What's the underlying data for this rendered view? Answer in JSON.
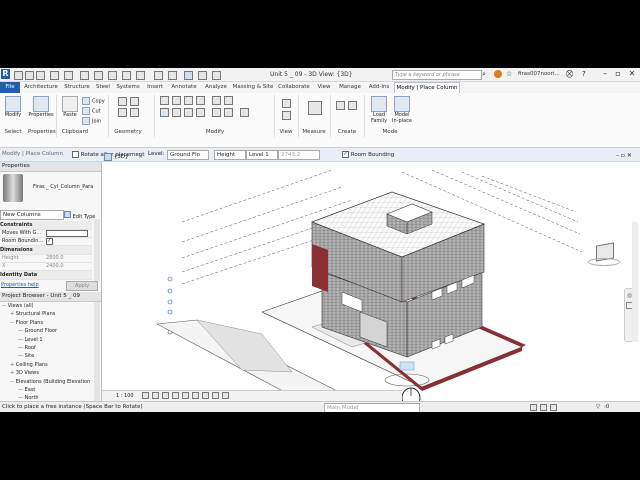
{
  "titlebar": {
    "logo": "R",
    "window_title": "Unit 5 _ 09 - 3D View: {3D}",
    "search_placeholder": "Type a keyword or phrase",
    "user": "firas007noori...",
    "help": "?"
  },
  "tabs": [
    "File",
    "Architecture",
    "Structure",
    "Steel",
    "Systems",
    "Insert",
    "Annotate",
    "Analyze",
    "Massing & Site",
    "Collaborate",
    "View",
    "Manage",
    "Add-Ins",
    "Modify | Place Column"
  ],
  "ribbon": {
    "modify_label": "Modify",
    "properties_label": "Properties",
    "paste_label": "Paste",
    "copy": "Copy",
    "cut": "Cut",
    "join": "Join",
    "load_family": "Load Family",
    "model_inplace": "Model In-place",
    "panels": {
      "select": "Select",
      "properties": "Properties",
      "clipboard": "Clipboard",
      "geometry": "Geometry",
      "modify": "Modify",
      "view": "View",
      "measure": "Measure",
      "create": "Create",
      "mode": "Mode"
    }
  },
  "options_bar": {
    "context": "Modify | Place Column",
    "rotate_after": "Rotate after placement",
    "level_label": "Level:",
    "level_value": "Ground Flo",
    "height_value": "Height",
    "top_level": "Level 1",
    "height_number": "2743.2",
    "room_bounding": "Room Bounding"
  },
  "view_tab": {
    "label": "{3D}"
  },
  "properties": {
    "header": "Properties",
    "family": "Firas _ Cyl_Column_Para",
    "selector": "New Columns",
    "edit_type": "Edit Type",
    "sections": {
      "constraints": "Constraints",
      "dimensions": "Dimensions",
      "identity": "Identity Data"
    },
    "rows": [
      {
        "name": "Moves With G...",
        "value": ""
      },
      {
        "name": "Room Boundin...",
        "value": ""
      },
      {
        "name": "Height",
        "value": "2800.0"
      },
      {
        "name": "X",
        "value": "2400.0"
      }
    ],
    "help_link": "Properties help",
    "apply": "Apply"
  },
  "browser": {
    "header": "Project Browser - Unit 5 _ 09",
    "items": [
      {
        "label": "Views (all)",
        "level": 0,
        "sign": "−"
      },
      {
        "label": "Structural Plans",
        "level": 1,
        "sign": "+"
      },
      {
        "label": "Floor Plans",
        "level": 1,
        "sign": "−"
      },
      {
        "label": "Ground Floor",
        "level": 2,
        "sign": ""
      },
      {
        "label": "Level 1",
        "level": 2,
        "sign": ""
      },
      {
        "label": "Roof",
        "level": 2,
        "sign": ""
      },
      {
        "label": "Site",
        "level": 2,
        "sign": ""
      },
      {
        "label": "Ceiling Plans",
        "level": 1,
        "sign": "+"
      },
      {
        "label": "3D Views",
        "level": 1,
        "sign": "+"
      },
      {
        "label": "Elevations (Building Elevation",
        "level": 1,
        "sign": "−"
      },
      {
        "label": "East",
        "level": 2,
        "sign": ""
      },
      {
        "label": "North",
        "level": 2,
        "sign": ""
      },
      {
        "label": "South",
        "level": 2,
        "sign": ""
      }
    ]
  },
  "viewbar": {
    "scale": "1 : 100"
  },
  "statusbar": {
    "message": "Click to place a free instance (Space Bar to Rotate)",
    "model": "Main Model",
    "selection_count": ":0"
  },
  "viewcube": {
    "label": "HOME"
  },
  "colors": {
    "revit_blue": "#1f5ea8",
    "wall_red": "#8a2f34",
    "brick": "#9a9a9a"
  }
}
